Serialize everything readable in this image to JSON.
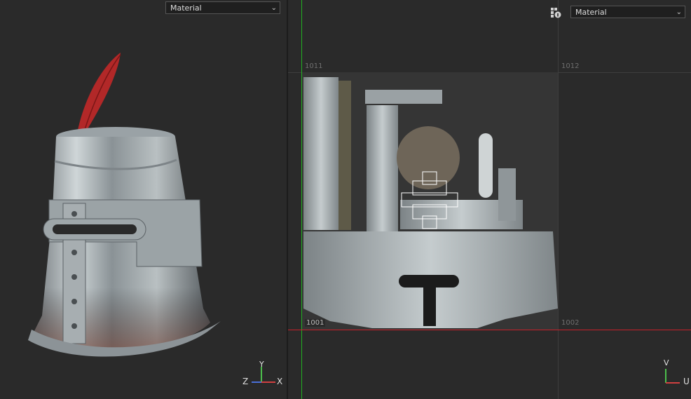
{
  "viewport_3d": {
    "material_select": "Material",
    "axes": {
      "z": "Z",
      "y": "Y",
      "x": "X"
    }
  },
  "viewport_2d": {
    "material_select": "Material",
    "udim_labels": {
      "top_left": "1011",
      "top_right": "1012",
      "bottom_left": "1001",
      "bottom_right": "1002"
    },
    "axes": {
      "v": "V",
      "u": "U"
    }
  },
  "colors": {
    "background": "#2a2a2a",
    "u_axis": "#c8202a",
    "v_axis": "#22b022",
    "grid": "#3d3d3d"
  }
}
